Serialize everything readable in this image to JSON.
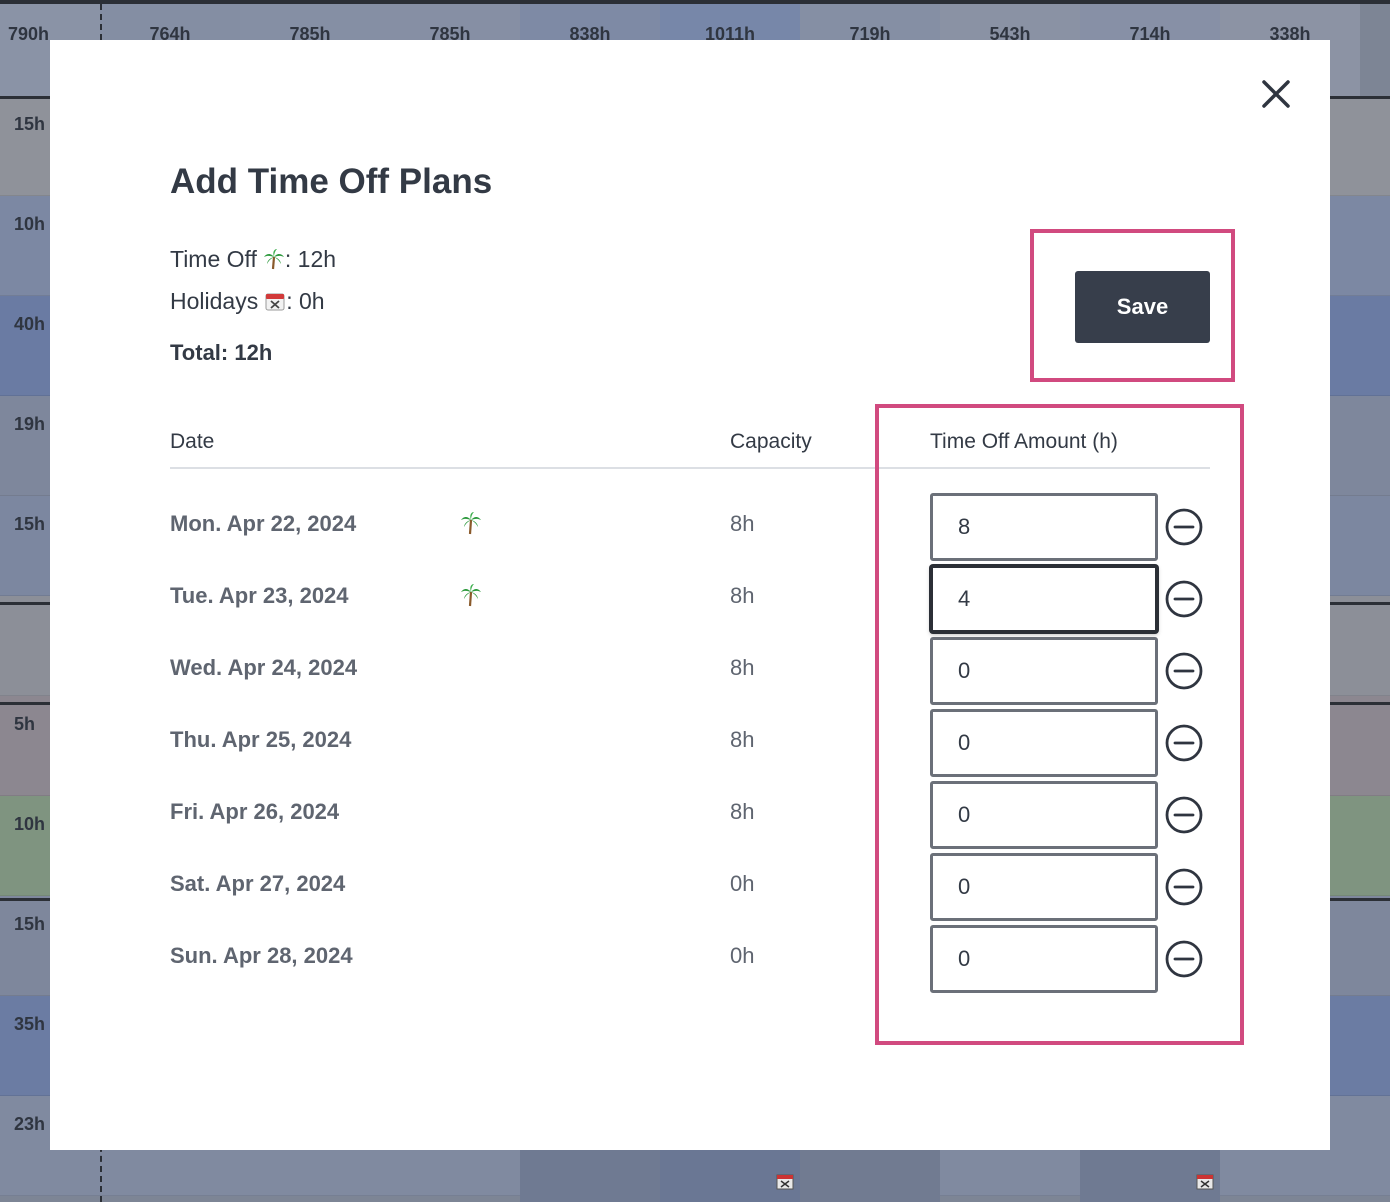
{
  "background": {
    "header_totals": [
      "790h",
      "764h",
      "785h",
      "785h",
      "838h",
      "1011h",
      "719h",
      "543h",
      "714h",
      "338h"
    ],
    "row_labels": [
      "15h",
      "10h",
      "40h",
      "19h",
      "15h",
      "",
      "5h",
      "10h",
      "15h",
      "35h",
      "23h"
    ]
  },
  "modal": {
    "title": "Add Time Off Plans",
    "summary": {
      "time_off_label": "Time Off",
      "time_off_value": ": 12h",
      "holidays_label": "Holidays",
      "holidays_value": ": 0h",
      "total": "Total: 12h"
    },
    "save_label": "Save",
    "table": {
      "headers": {
        "date": "Date",
        "capacity": "Capacity",
        "amount": "Time Off Amount (h)"
      },
      "rows": [
        {
          "date": "Mon. Apr 22, 2024",
          "palm": true,
          "capacity": "8h",
          "amount": "8"
        },
        {
          "date": "Tue. Apr 23, 2024",
          "palm": true,
          "capacity": "8h",
          "amount": "4"
        },
        {
          "date": "Wed. Apr 24, 2024",
          "palm": false,
          "capacity": "8h",
          "amount": "0"
        },
        {
          "date": "Thu. Apr 25, 2024",
          "palm": false,
          "capacity": "8h",
          "amount": "0"
        },
        {
          "date": "Fri. Apr 26, 2024",
          "palm": false,
          "capacity": "8h",
          "amount": "0"
        },
        {
          "date": "Sat. Apr 27, 2024",
          "palm": false,
          "capacity": "0h",
          "amount": "0"
        },
        {
          "date": "Sun. Apr 28, 2024",
          "palm": false,
          "capacity": "0h",
          "amount": "0"
        }
      ]
    }
  },
  "colors": {
    "highlight": "#d14a7f",
    "save_button": "#373e4b",
    "text_primary": "#333a45",
    "text_secondary": "#5f6570"
  }
}
